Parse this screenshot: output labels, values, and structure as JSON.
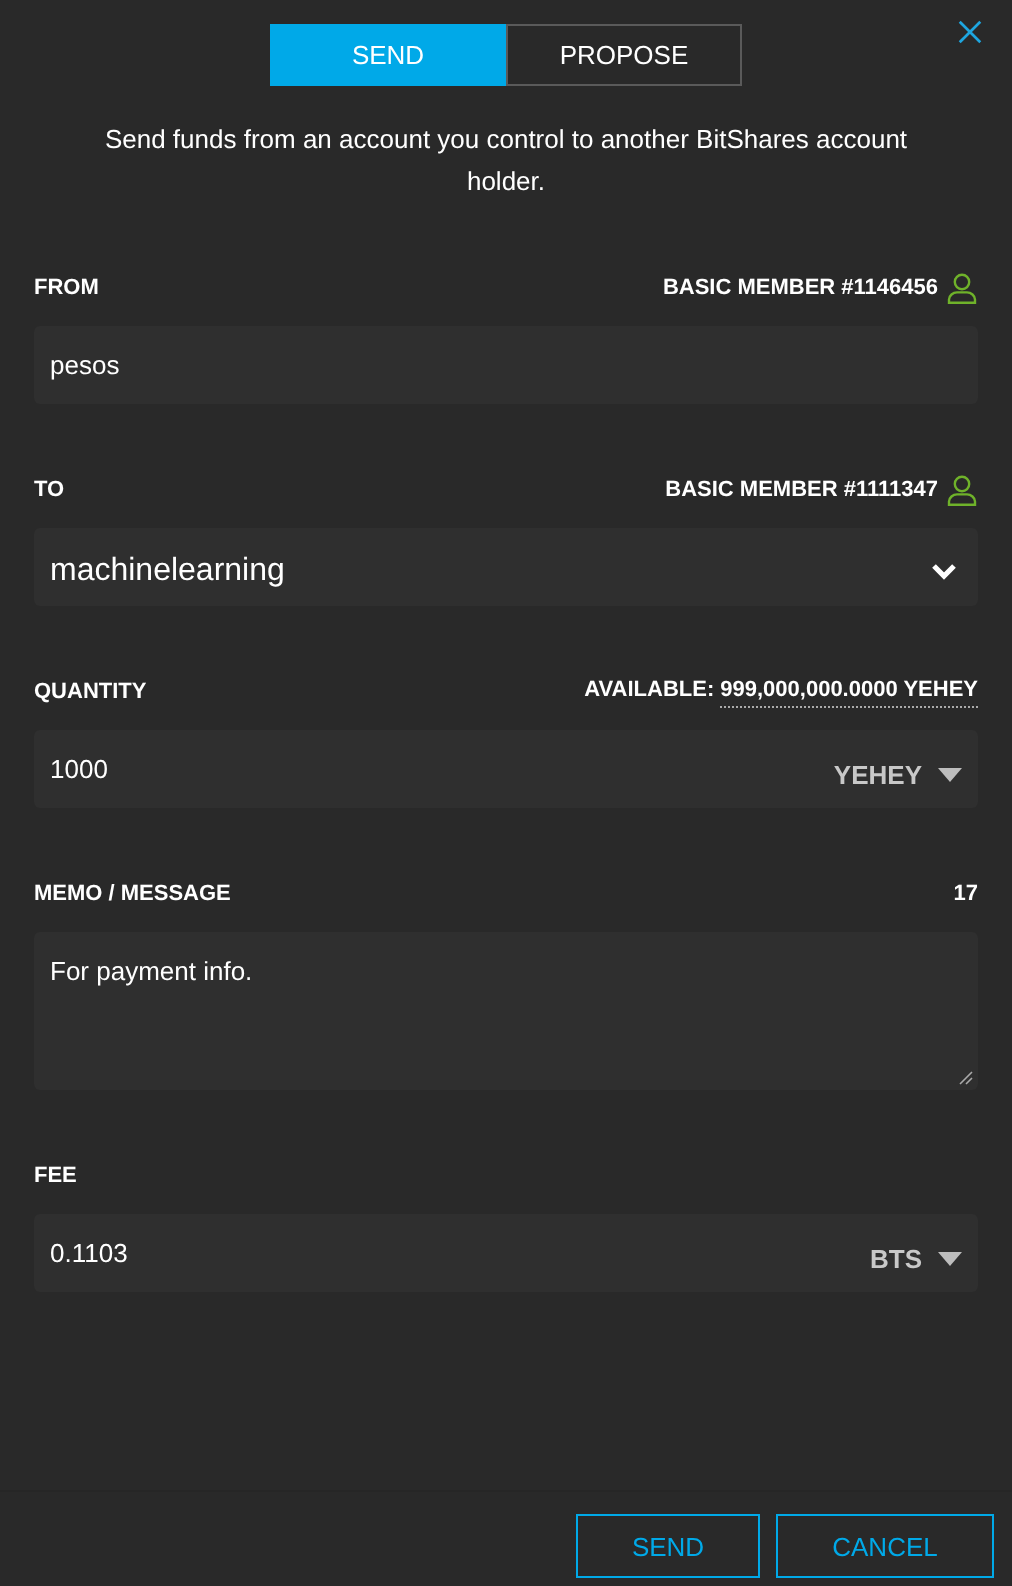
{
  "tabs": [
    {
      "label": "SEND",
      "selected": true
    },
    {
      "label": "PROPOSE",
      "selected": false
    }
  ],
  "description": "Send funds from an account you control to another BitShares account holder.",
  "sections": [
    {
      "kind": "account",
      "label": "FROM",
      "member": "BASIC MEMBER #1146456",
      "value": "pesos"
    },
    {
      "kind": "select",
      "label": "TO",
      "member": "BASIC MEMBER #1111347",
      "value": "machinelearning"
    },
    {
      "kind": "amount",
      "label": "QUANTITY",
      "available_label": "AVAILABLE:",
      "available": "999,000,000.0000 YEHEY",
      "value": "1000",
      "asset": "YEHEY"
    },
    {
      "kind": "memo",
      "label": "MEMO / MESSAGE",
      "count": "17",
      "value": "For payment info."
    },
    {
      "kind": "amount",
      "label": "FEE",
      "value": "0.1103",
      "asset": "BTS"
    }
  ],
  "buttons": [
    "SEND",
    "CANCEL"
  ]
}
